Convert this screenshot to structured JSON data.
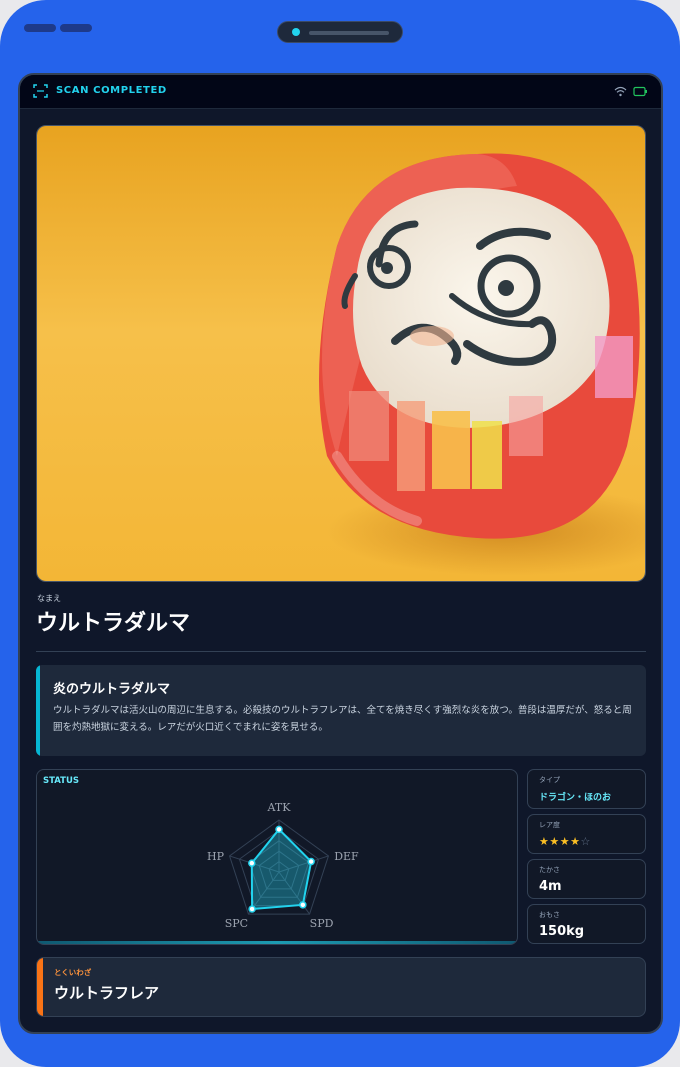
{
  "header": {
    "scan_status": "SCAN COMPLETED",
    "icons": [
      "scan-frame-icon",
      "wifi-icon",
      "battery-icon"
    ]
  },
  "photo": {
    "subject": "red daruma doll on orange background"
  },
  "name": {
    "kana_label": "なまえ",
    "title": "ウルトラダルマ"
  },
  "description": {
    "title": "炎のウルトラダルマ",
    "body": "ウルトラダルマは活火山の周辺に生息する。必殺技のウルトラフレアは、全てを焼き尽くす強烈な炎を放つ。普段は温厚だが、怒ると周囲を灼熱地獄に変える。レアだが火口近くでまれに姿を見せる。"
  },
  "status": {
    "label": "STATUS",
    "stats": [
      {
        "label": "ATK",
        "value": 0.82
      },
      {
        "label": "DEF",
        "value": 0.65
      },
      {
        "label": "SPD",
        "value": 0.78
      },
      {
        "label": "SPC",
        "value": 0.88
      },
      {
        "label": "HP",
        "value": 0.55
      }
    ]
  },
  "info": {
    "type": {
      "label": "タイプ",
      "value": "ドラゴン・ほのお"
    },
    "rarity": {
      "label": "レア度",
      "stars": 4,
      "max": 5
    },
    "height": {
      "label": "たかさ",
      "value": "4m"
    },
    "weight": {
      "label": "おもさ",
      "value": "150kg"
    }
  },
  "move": {
    "label": "とくいわざ",
    "name": "ウルトラフレア"
  },
  "colors": {
    "accent": "#22d3ee",
    "frame": "#2563eb",
    "screen": "#0f172a",
    "move_accent": "#f97316",
    "star": "#fbbf24"
  }
}
